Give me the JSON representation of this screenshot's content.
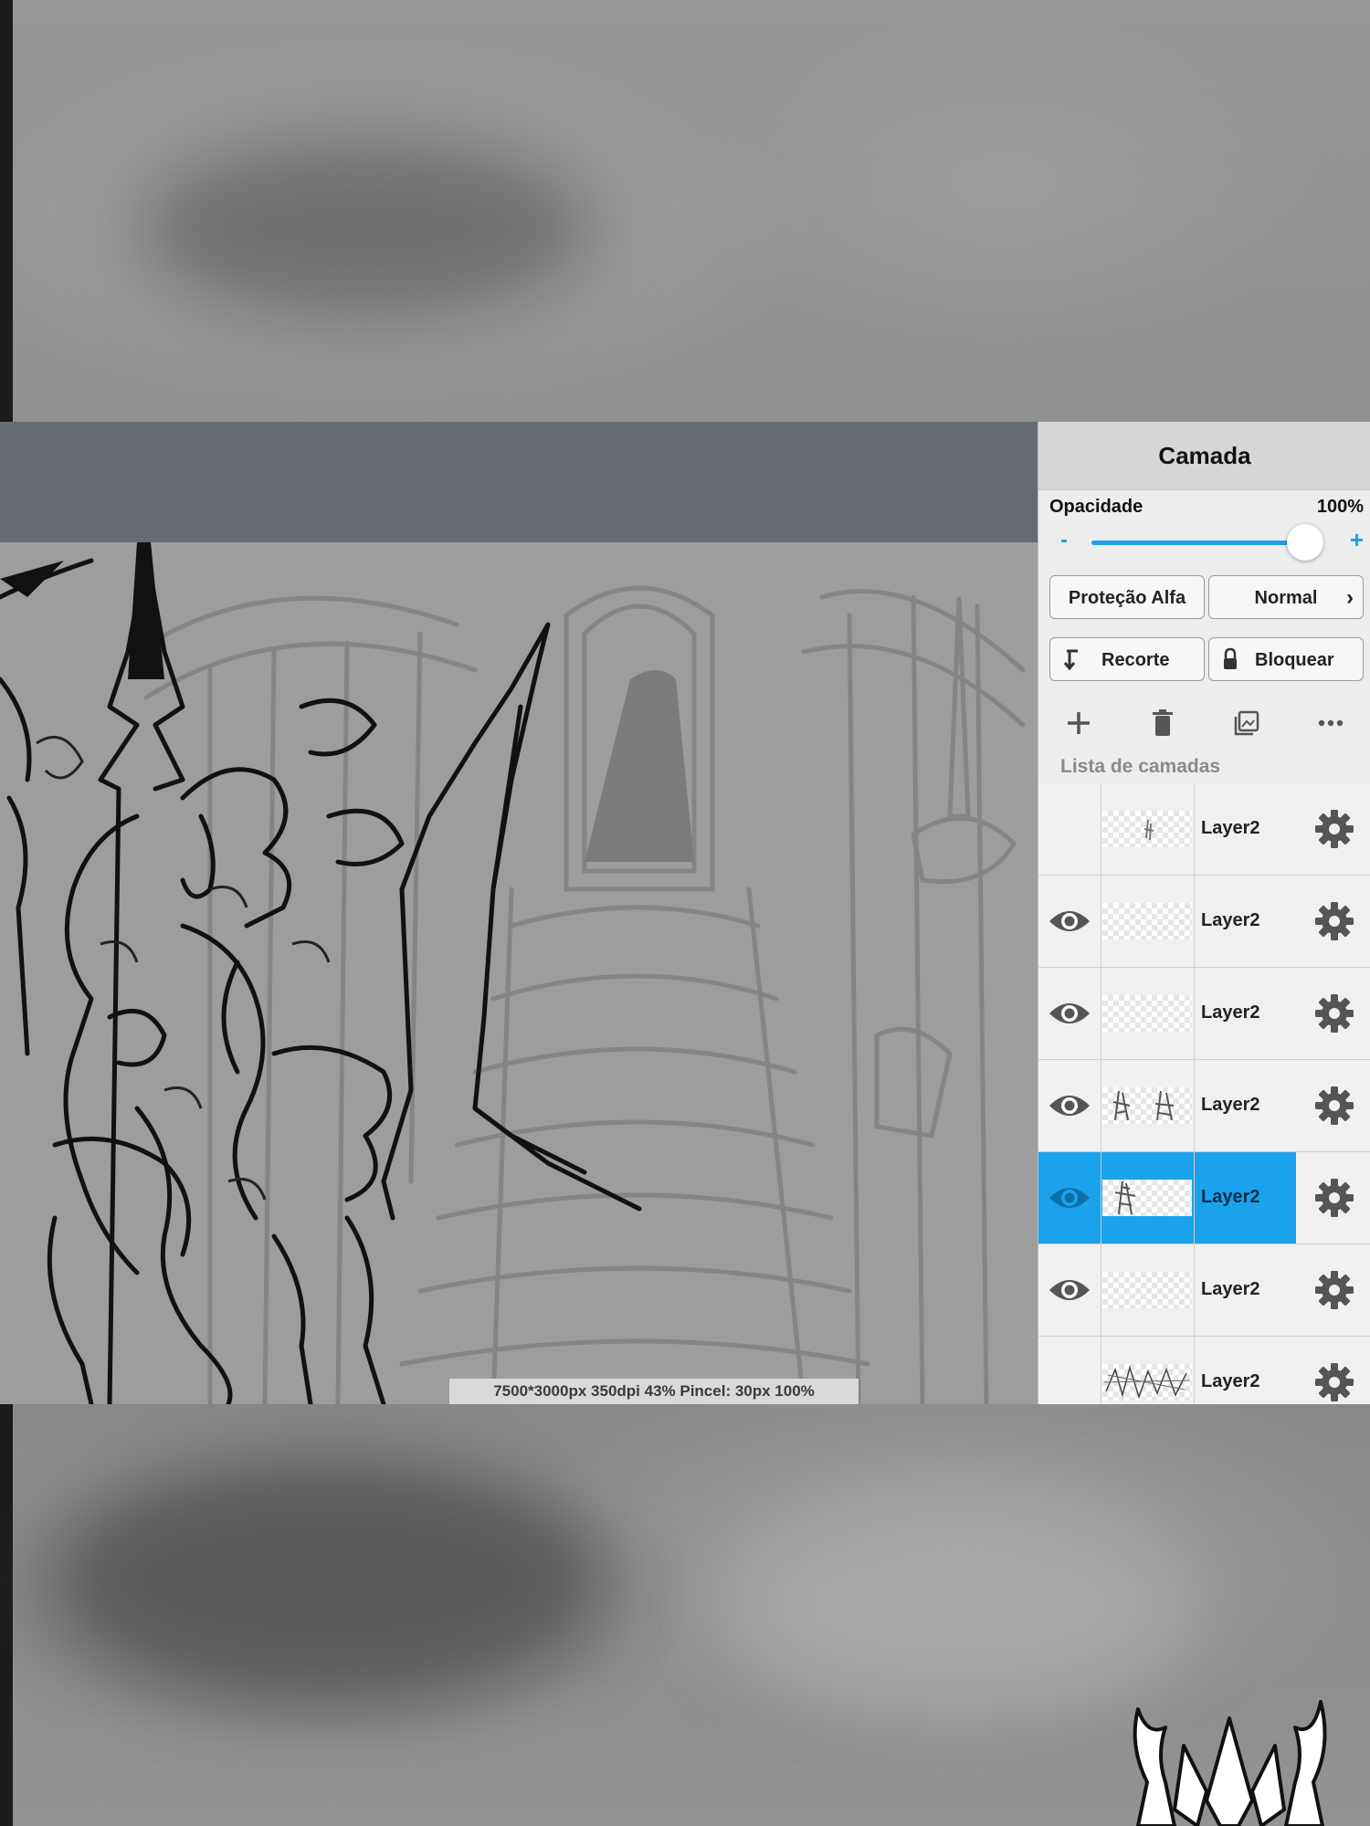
{
  "panel": {
    "title": "Camada",
    "opacity_label": "Opacidade",
    "opacity_value": "100%",
    "opacity_level": 1.0,
    "slider_minus": "-",
    "slider_plus": "+",
    "alpha_protect_label": "Proteção Alfa",
    "blend_mode_label": "Normal",
    "clipping_label": "Recorte",
    "lock_label": "Bloquear",
    "layer_list_title": "Lista de camadas",
    "accent_color": "#1aa3ec"
  },
  "layers": [
    {
      "name": "Layer2",
      "visible": false,
      "selected": false,
      "thumb": "small-figure"
    },
    {
      "name": "Layer2",
      "visible": true,
      "selected": false,
      "thumb": "empty"
    },
    {
      "name": "Layer2",
      "visible": true,
      "selected": false,
      "thumb": "empty"
    },
    {
      "name": "Layer2",
      "visible": true,
      "selected": false,
      "thumb": "two-figures"
    },
    {
      "name": "Layer2",
      "visible": true,
      "selected": true,
      "thumb": "figure"
    },
    {
      "name": "Layer2",
      "visible": true,
      "selected": false,
      "thumb": "empty"
    },
    {
      "name": "Layer2",
      "visible": true,
      "selected": false,
      "thumb": "full-sketch"
    }
  ],
  "canvas": {
    "status_text": "7500*3000px 350dpi 43% Pincel: 30px 100%"
  },
  "icons": {
    "add": "plus-icon",
    "delete": "trash-icon",
    "image": "image-layer-icon",
    "more": "more-dots-icon",
    "visibility": "eye-icon",
    "settings": "gear-icon",
    "clip": "clip-arrow-icon",
    "lock": "lock-icon",
    "chevron": "chevron-right-icon"
  }
}
